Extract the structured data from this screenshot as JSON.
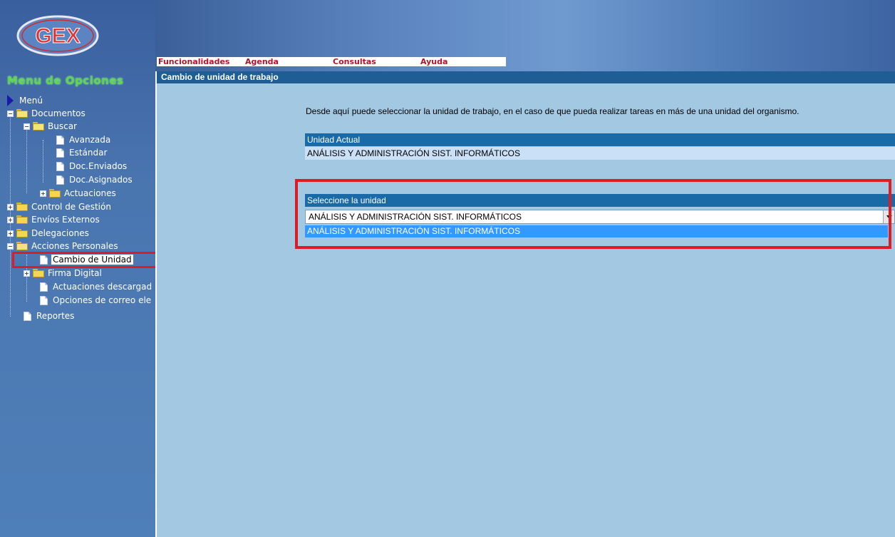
{
  "logo": {
    "text": "GEX"
  },
  "sidebar": {
    "title": "Menu de Opciones",
    "tree": {
      "root": "Menú",
      "documentos": "Documentos",
      "buscar": "Buscar",
      "avanzada": "Avanzada",
      "estandar": "Estándar",
      "doc_enviados": "Doc.Enviados",
      "doc_asignados": "Doc.Asignados",
      "actuaciones": "Actuaciones",
      "control_gestion": "Control de Gestión",
      "envios_externos": "Envíos Externos",
      "delegaciones": "Delegaciones",
      "acciones_personales": "Acciones Personales",
      "cambio_unidad": "Cambio de Unidad",
      "firma_digital": "Firma Digital",
      "actuaciones_descargadas": "Actuaciones descargad",
      "opciones_correo": "Opciones de correo ele",
      "reportes": "Reportes"
    }
  },
  "tabs": [
    {
      "label": "Funcionalidades"
    },
    {
      "label": "Agenda"
    },
    {
      "label": "Consultas"
    },
    {
      "label": "Ayuda"
    }
  ],
  "main": {
    "section_title": "Cambio de unidad de trabajo",
    "description": "Desde aquí puede seleccionar la unidad de trabajo, en el caso de que pueda realizar tareas en más de una unidad del organismo.",
    "current_unit_label": "Unidad Actual",
    "current_unit_value": "ANÁLISIS Y ADMINISTRACIÓN SIST. INFORMÁTICOS",
    "select_label": "Seleccione la unidad",
    "select_value": "ANÁLISIS Y ADMINISTRACIÓN SIST. INFORMÁTICOS",
    "select_options": [
      "ANÁLISIS Y ADMINISTRACIÓN SIST. INFORMÁTICOS"
    ]
  },
  "colors": {
    "highlight": "#e01b22",
    "section_header": "#1e5e94",
    "bar": "#1b6aa8",
    "content_bg": "#a3c8e2",
    "option_selected": "#3399ff"
  }
}
